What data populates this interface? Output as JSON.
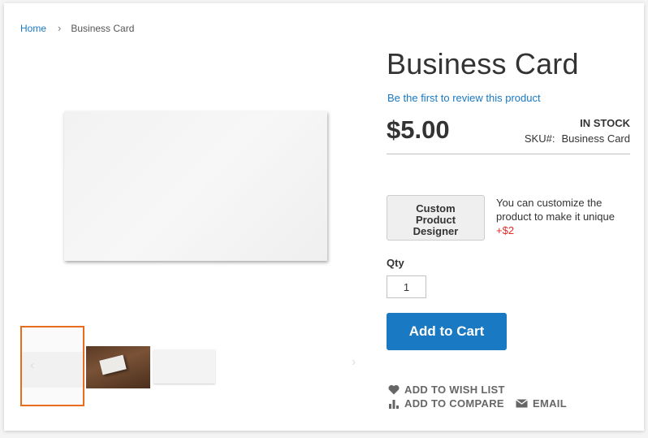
{
  "breadcrumb": {
    "home": "Home",
    "separator": "›",
    "current": "Business Card"
  },
  "gallery": {
    "prev": "‹",
    "next": "›"
  },
  "product": {
    "title": "Business Card",
    "review_link": "Be the first to review this product",
    "price": "$5.00",
    "stock": "IN STOCK",
    "sku_label": "SKU#:",
    "sku_value": "Business Card"
  },
  "designer": {
    "button_label_line1": "Custom",
    "button_label_line2": "Product",
    "button_label_line3": "Designer",
    "note": "You can customize the product to make it unique",
    "price_add": "+$2"
  },
  "qty": {
    "label": "Qty",
    "value": "1"
  },
  "cart": {
    "add_label": "Add to Cart"
  },
  "actions": {
    "wish": "Add to Wish List",
    "compare": "Add to Compare",
    "email": "Email"
  },
  "colors": {
    "accent": "#1979c3",
    "thumb_active_border": "#e86c1b",
    "price_add": "#e02b27"
  }
}
